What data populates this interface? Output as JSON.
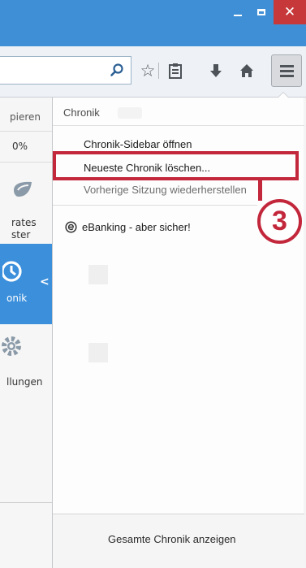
{
  "window": {
    "close_glyph": "✕",
    "accent_color": "#3f8fd6",
    "close_color": "#c7383a"
  },
  "toolbar": {
    "icons": [
      "search-icon",
      "star-icon",
      "reading-list-icon",
      "download-icon",
      "home-icon",
      "hamburger-menu-icon"
    ]
  },
  "back_menu": {
    "copy_label": "pieren",
    "zoom_value": "0%",
    "private_label_1": "rates",
    "private_label_2": "ster",
    "history_label": "onik",
    "settings_label": "llungen"
  },
  "history_panel": {
    "title": "Chronik",
    "items": [
      {
        "label": "Chronik-Sidebar öffnen",
        "enabled": true
      },
      {
        "label": "Neueste Chronik löschen...",
        "enabled": true,
        "highlighted": true
      },
      {
        "label": "Vorherige Sitzung wiederherstellen",
        "enabled": false
      }
    ],
    "recent": [
      {
        "label": "eBanking - aber sicher!",
        "icon": "ebanking-favicon"
      }
    ],
    "footer_button": "Gesamte Chronik anzeigen"
  },
  "annotation": {
    "step_number": "3",
    "color": "#c3273b"
  }
}
